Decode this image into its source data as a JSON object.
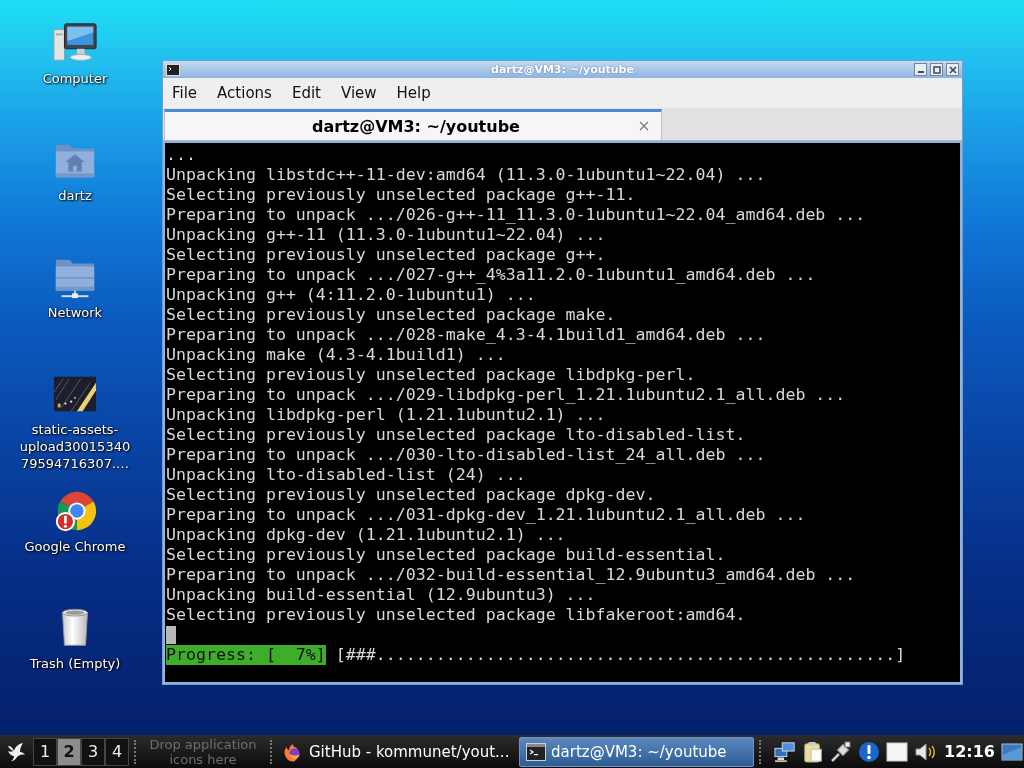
{
  "desktop": {
    "icons": [
      {
        "label": "Computer",
        "kind": "computer"
      },
      {
        "label": "dartz",
        "kind": "home_folder"
      },
      {
        "label": "Network",
        "kind": "network_folder"
      },
      {
        "label": "static-assets-upload3001534079594716307.…",
        "kind": "image_file"
      },
      {
        "label": "Google Chrome",
        "kind": "browser"
      },
      {
        "label": "Trash (Empty)",
        "kind": "trash"
      }
    ]
  },
  "terminal_window": {
    "title": "dartz@VM3: ~/youtube",
    "menu": [
      "File",
      "Actions",
      "Edit",
      "View",
      "Help"
    ],
    "tabs": [
      {
        "label": "dartz@VM3: ~/youtube",
        "selected": true
      }
    ],
    "lines": [
      "...",
      "Unpacking libstdc++-11-dev:amd64 (11.3.0-1ubuntu1~22.04) ...",
      "Selecting previously unselected package g++-11.",
      "Preparing to unpack .../026-g++-11_11.3.0-1ubuntu1~22.04_amd64.deb ...",
      "Unpacking g++-11 (11.3.0-1ubuntu1~22.04) ...",
      "Selecting previously unselected package g++.",
      "Preparing to unpack .../027-g++_4%3a11.2.0-1ubuntu1_amd64.deb ...",
      "Unpacking g++ (4:11.2.0-1ubuntu1) ...",
      "Selecting previously unselected package make.",
      "Preparing to unpack .../028-make_4.3-4.1build1_amd64.deb ...",
      "Unpacking make (4.3-4.1build1) ...",
      "Selecting previously unselected package libdpkg-perl.",
      "Preparing to unpack .../029-libdpkg-perl_1.21.1ubuntu2.1_all.deb ...",
      "Unpacking libdpkg-perl (1.21.1ubuntu2.1) ...",
      "Selecting previously unselected package lto-disabled-list.",
      "Preparing to unpack .../030-lto-disabled-list_24_all.deb ...",
      "Unpacking lto-disabled-list (24) ...",
      "Selecting previously unselected package dpkg-dev.",
      "Preparing to unpack .../031-dpkg-dev_1.21.1ubuntu2.1_all.deb ...",
      "Unpacking dpkg-dev (1.21.1ubuntu2.1) ...",
      "Selecting previously unselected package build-essential.",
      "Preparing to unpack .../032-build-essential_12.9ubuntu3_amd64.deb ...",
      "Unpacking build-essential (12.9ubuntu3) ...",
      "Selecting previously unselected package libfakeroot:amd64."
    ],
    "progress": {
      "label": "Progress: [  7%]",
      "bar": "[###....................................................]"
    }
  },
  "taskbar": {
    "workspaces": [
      {
        "label": "1",
        "selected": false
      },
      {
        "label": "2",
        "selected": true
      },
      {
        "label": "3",
        "selected": false
      },
      {
        "label": "4",
        "selected": false
      }
    ],
    "launcher_hint": "Drop application icons here",
    "tasks": [
      {
        "label": "GitHub - kommunet/yout...",
        "kind": "browser",
        "selected": false
      },
      {
        "label": "dartz@VM3: ~/youtube",
        "kind": "terminal",
        "selected": true
      }
    ],
    "clock": "12:16"
  }
}
